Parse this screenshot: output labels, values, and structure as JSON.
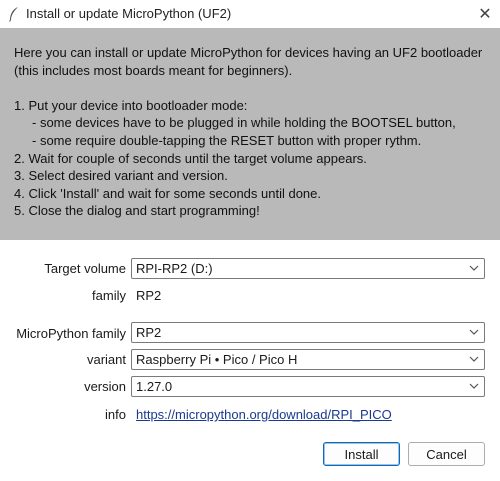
{
  "window": {
    "title": "Install or update MicroPython (UF2)",
    "close_glyph": "✕",
    "icon": "feather-icon"
  },
  "instructions": {
    "intro_1": "Here you can install or update MicroPython for devices having an UF2 bootloader",
    "intro_2": "(this includes most boards meant for beginners).",
    "step_1": "1. Put your device into bootloader mode:",
    "step_1a": "- some devices have to be plugged in while holding the BOOTSEL button,",
    "step_1b": "- some require double-tapping the RESET button with proper rythm.",
    "step_2": "2. Wait for couple of seconds until the target volume appears.",
    "step_3": "3. Select desired variant and version.",
    "step_4": "4. Click 'Install' and wait for some seconds until done.",
    "step_5": "5. Close the dialog and start programming!"
  },
  "form": {
    "target_volume": {
      "label": "Target volume",
      "value": "RPI-RP2 (D:)"
    },
    "family": {
      "label": "family",
      "value": "RP2"
    },
    "micropython_family": {
      "label": "MicroPython family",
      "value": "RP2"
    },
    "variant": {
      "label": "variant",
      "value": "Raspberry Pi • Pico / Pico H"
    },
    "version": {
      "label": "version",
      "value": "1.27.0"
    },
    "info": {
      "label": "info",
      "link": "https://micropython.org/download/RPI_PICO"
    }
  },
  "buttons": {
    "install": "Install",
    "cancel": "Cancel"
  },
  "colors": {
    "instructions_bg": "#b9b9b9",
    "link": "#1a3a8f",
    "default_button_border": "#0f67b8"
  }
}
